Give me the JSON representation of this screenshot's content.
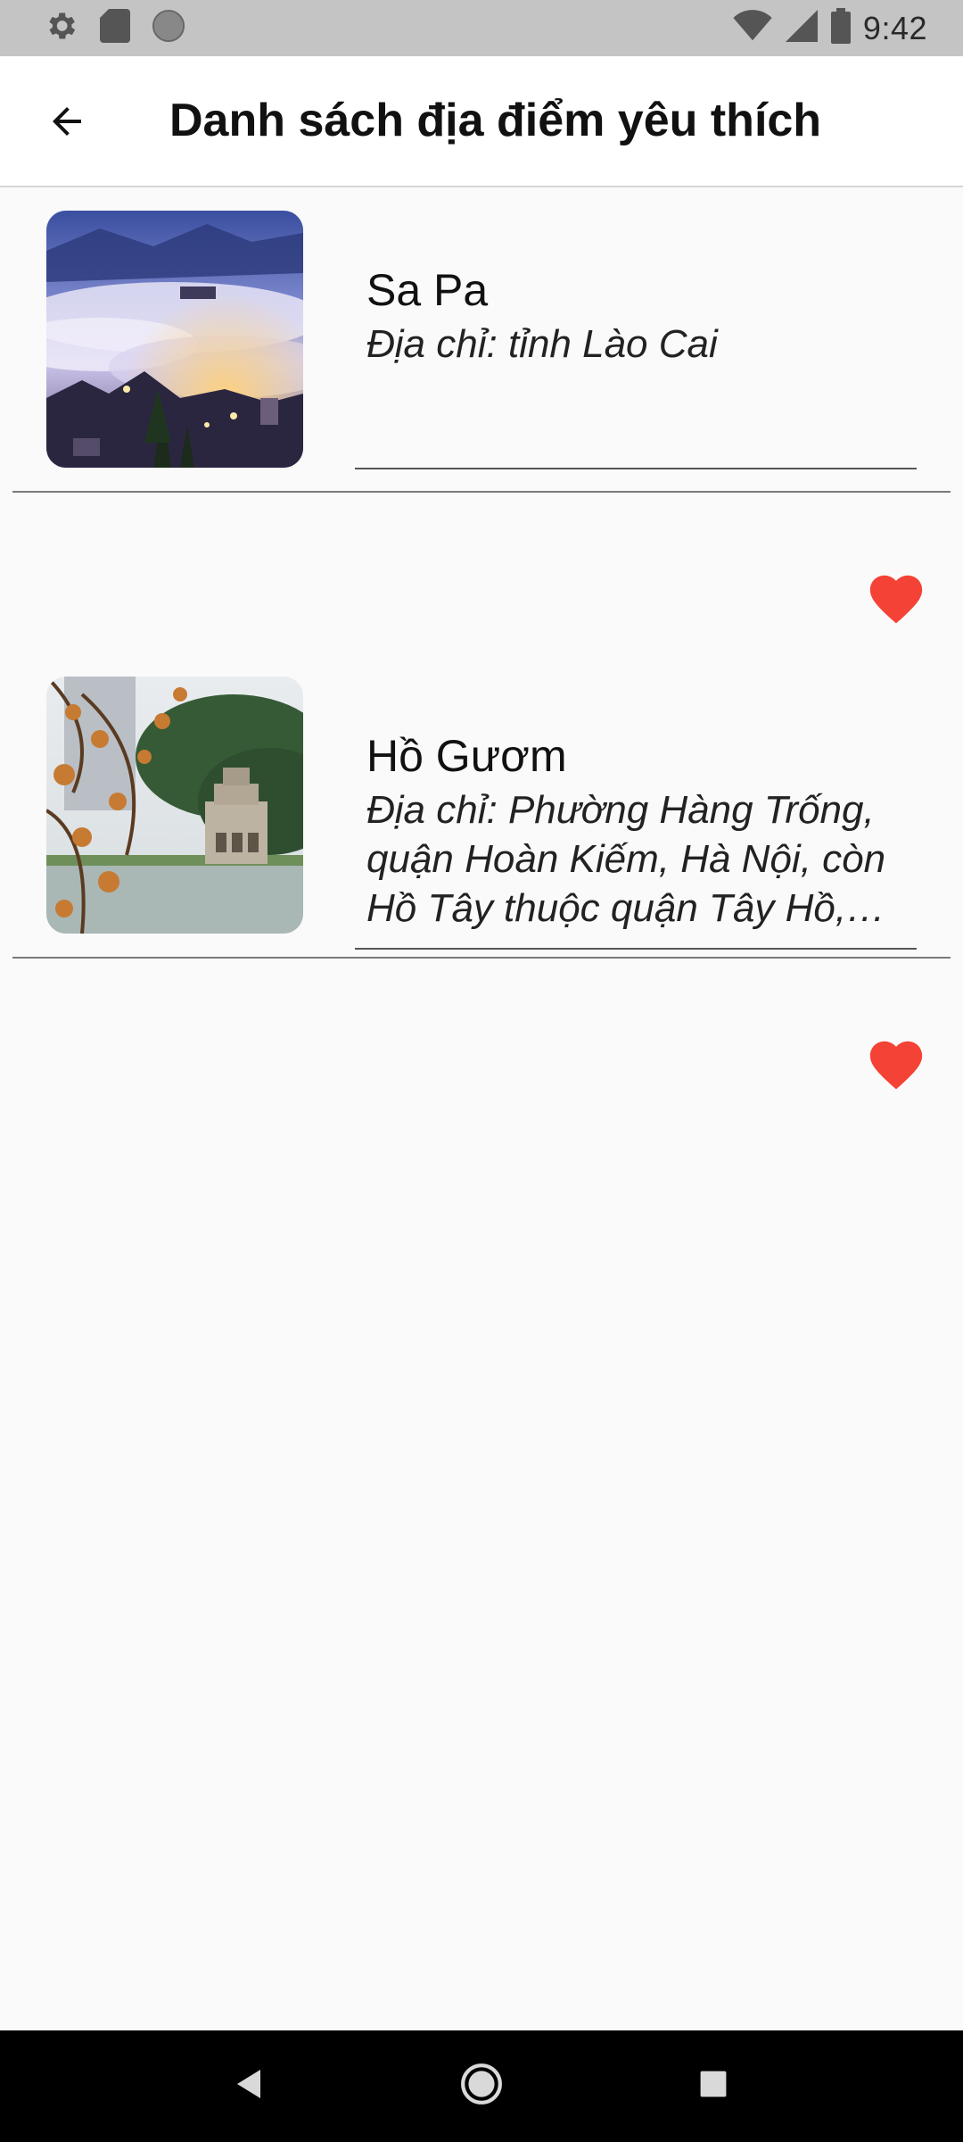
{
  "status_bar": {
    "time": "9:42",
    "icons_left": [
      "settings-icon",
      "sd-card-icon",
      "circle-icon"
    ],
    "icons_right": [
      "wifi-icon",
      "signal-icon",
      "battery-icon"
    ]
  },
  "app_bar": {
    "title": "Danh sách địa điểm yêu thích",
    "back_icon": "arrow-left-icon"
  },
  "places": [
    {
      "name": "Sa Pa",
      "address": "Địa chỉ: tỉnh Lào Cai",
      "favorite": true,
      "favorite_color": "#f44336",
      "image": "sapa-misty-town-photo"
    },
    {
      "name": "Hồ Gươm",
      "address": "Địa chỉ: Phường Hàng Trống, quận Hoàn Kiếm, Hà Nội, còn Hồ Tây thuộc quận Tây Hồ, Hà Nội",
      "favorite": true,
      "favorite_color": "#f44336",
      "image": "ho-guom-turtle-tower-photo"
    }
  ],
  "nav_bar": {
    "buttons": [
      "back-nav-icon",
      "home-nav-icon",
      "recents-nav-icon"
    ]
  }
}
